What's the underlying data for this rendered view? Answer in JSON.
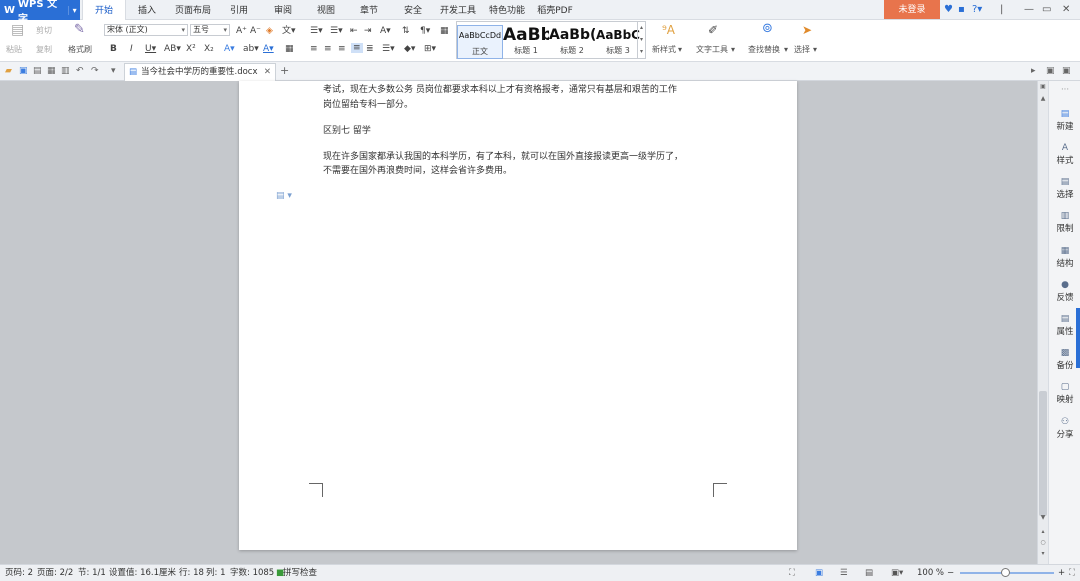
{
  "app": {
    "name": "WPS 文字",
    "login": "未登录"
  },
  "menu": {
    "tabs": [
      "开始",
      "插入",
      "页面布局",
      "引用",
      "审阅",
      "视图",
      "章节",
      "安全",
      "开发工具",
      "特色功能",
      "稻壳PDF"
    ],
    "active": "开始"
  },
  "ribbon": {
    "paste": "粘贴",
    "cut": "剪切",
    "copy": "复制",
    "format_painter": "格式刷",
    "font_name": "宋体 (正文)",
    "font_size": "五号",
    "styles": [
      {
        "preview": "AaBbCcDd",
        "name": "正文"
      },
      {
        "preview": "AaBb",
        "name": "标题 1"
      },
      {
        "preview": "AaBb(",
        "name": "标题 2"
      },
      {
        "preview": "AaBbC",
        "name": "标题 3"
      }
    ],
    "new_style": "新样式",
    "text_tools": "文字工具",
    "find_replace": "查找替换",
    "select": "选择"
  },
  "document": {
    "tab_name": "当今社会中学历的重要性.docx",
    "lines": [
      "考试，现在大多数公务 员岗位都要求本科以上才有资格报考，通常只有基层和艰苦的工作",
      "岗位留给专科一部分。",
      "区别七 留学",
      "现在许多国家都承认我国的本科学历，有了本科，就可以在国外直接报读更高一级学历了，",
      "不需要在国外再浪费时间，这样会省许多费用。"
    ]
  },
  "right_panel": [
    "新建",
    "样式",
    "选择",
    "限制",
    "结构",
    "反馈",
    "属性",
    "备份",
    "映射",
    "分享"
  ],
  "status": {
    "page_num": "页码: 2",
    "pages": "页面: 2/2",
    "section": "节: 1/1",
    "setting": "设置值: 16.1厘米",
    "row": "行: 18",
    "col": "列: 1",
    "words": "字数: 1085",
    "spell": "拼写检查",
    "zoom": "100 %"
  },
  "colors": {
    "accent": "#2a6fd6",
    "login": "#e8744c"
  }
}
